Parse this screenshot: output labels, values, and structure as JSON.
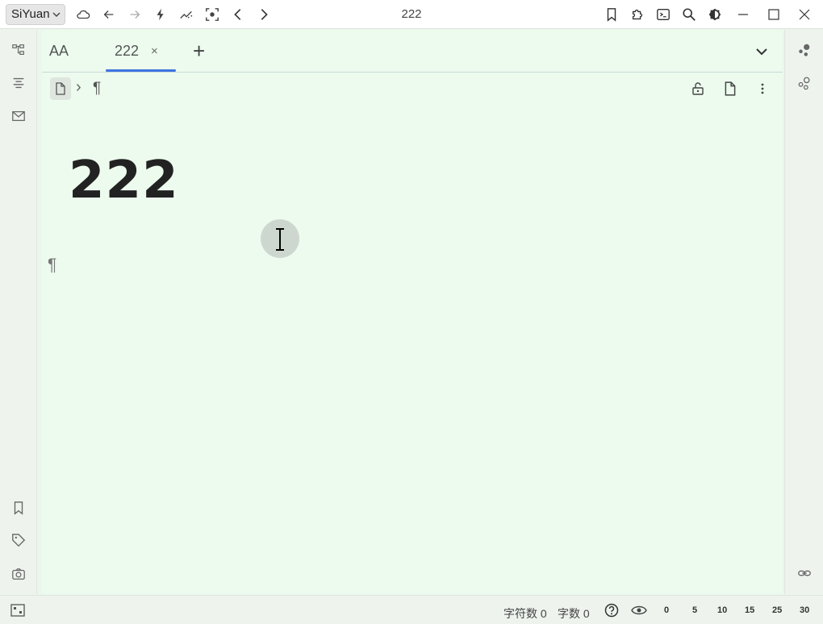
{
  "titlebar": {
    "brand": "SiYuan",
    "title": "222",
    "icons": [
      "cloud-icon",
      "arrow-left-icon",
      "arrow-right-icon",
      "lightning-icon",
      "chart-icon",
      "focus-icon",
      "chevron-left-icon",
      "chevron-right-icon",
      "bookmark-icon",
      "plugin-icon",
      "terminal-icon",
      "search-icon",
      "theme-icon",
      "minimize-icon",
      "maximize-icon",
      "close-icon"
    ]
  },
  "tabs": [
    {
      "label": "AA",
      "active": false
    },
    {
      "label": "222",
      "active": true,
      "close": "×"
    }
  ],
  "tabbar": {
    "add": "+"
  },
  "breadcrumb": {
    "separator": "›",
    "pilcrow": "¶"
  },
  "document": {
    "title": "222",
    "block_marker": "¶"
  },
  "statusbar": {
    "chars_label": "字符数 0",
    "words_label": "字数 0",
    "zoom_levels": [
      "0",
      "5",
      "10",
      "15",
      "25",
      "30"
    ]
  },
  "colors": {
    "accent": "#3f74e0",
    "editor_bg": "#ecfbee",
    "dock_bg": "#eef3ee"
  }
}
